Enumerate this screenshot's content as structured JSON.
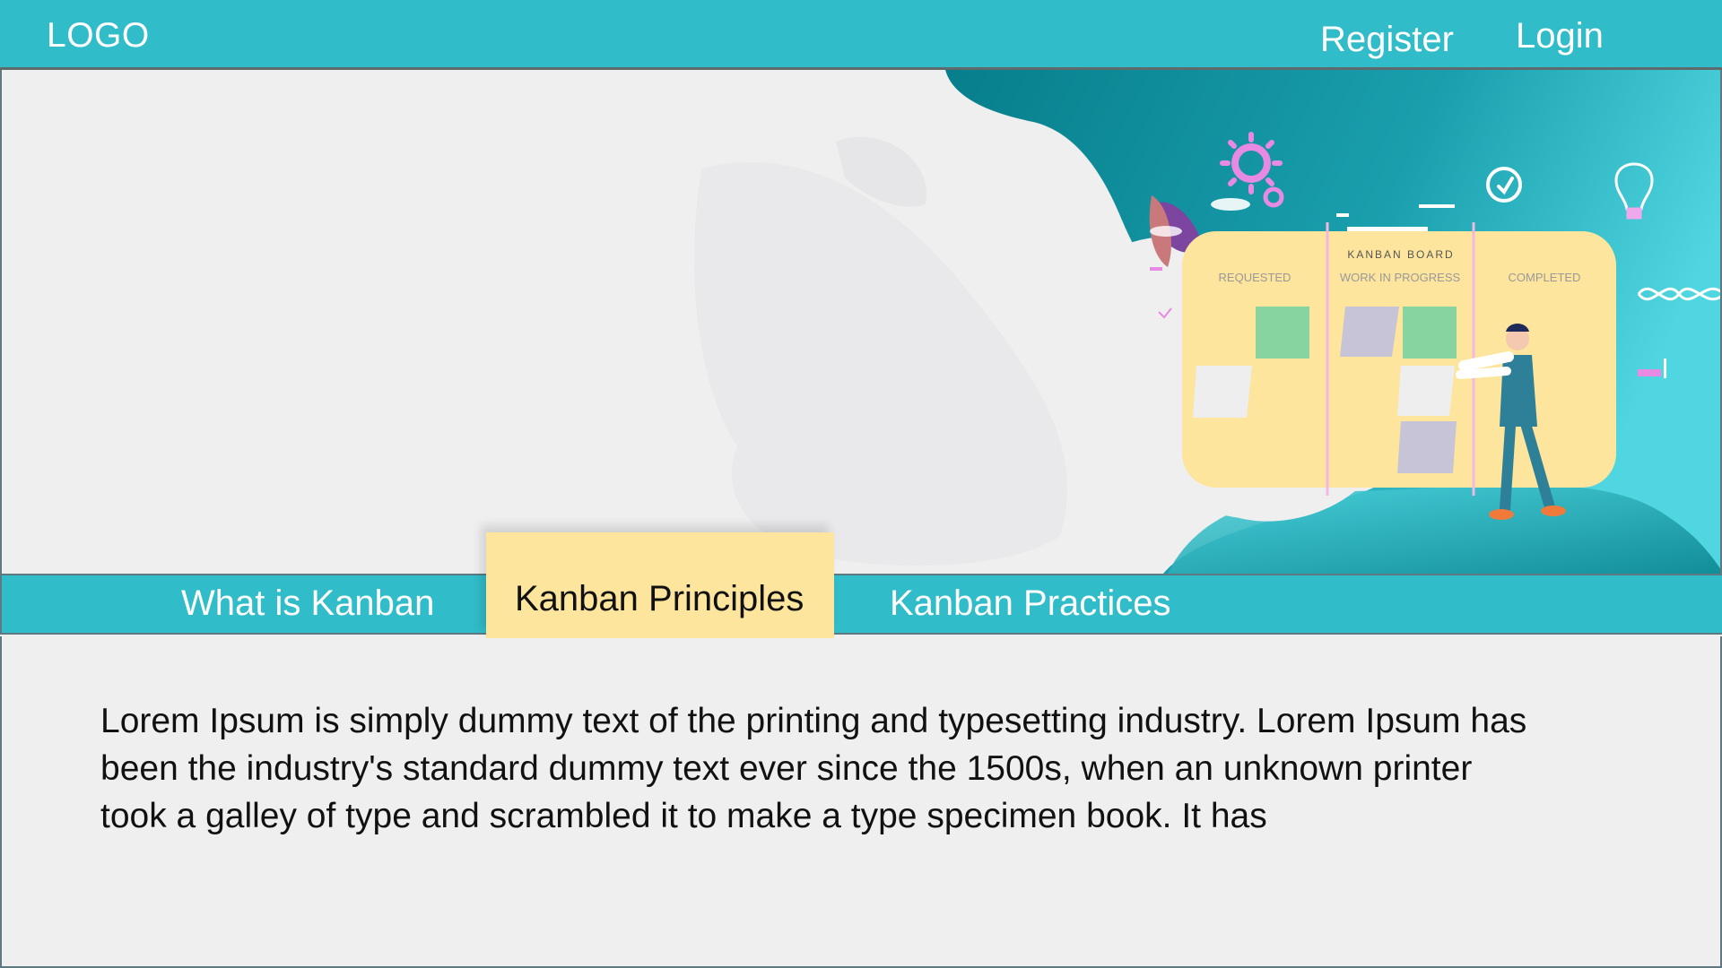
{
  "header": {
    "logo": "LOGO",
    "register_label": "Register",
    "login_label": "Login"
  },
  "hero": {
    "illustration": {
      "board_title": "KANBAN BOARD",
      "columns": [
        "REQUESTED",
        "WORK IN PROGRESS",
        "COMPLETED"
      ]
    }
  },
  "tabs": [
    {
      "label": "What is Kanban",
      "active": false
    },
    {
      "label": "Kanban Principles",
      "active": true
    },
    {
      "label": "Kanban Practices",
      "active": false
    }
  ],
  "content": {
    "text": "Lorem Ipsum is simply dummy text of the printing and typesetting industry. Lorem Ipsum has been the industry's standard dummy text ever since the 1500s, when an unknown printer took a galley of type and scrambled it to make a type specimen book. It has"
  },
  "colors": {
    "brand": "#31bcc9",
    "accent_tab": "#fde59d",
    "background": "#f0efef",
    "teal_dark": "#0a8590"
  },
  "icons": [
    "gear-icon",
    "check-circle-icon",
    "lightbulb-icon",
    "wave-icon"
  ]
}
